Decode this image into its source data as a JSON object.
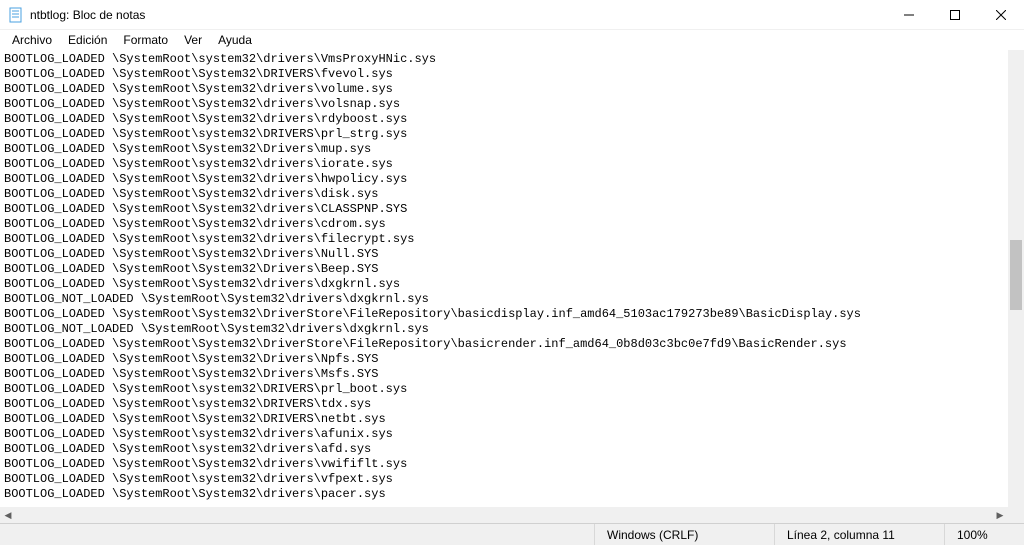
{
  "titlebar": {
    "title": "ntbtlog: Bloc de notas"
  },
  "menu": {
    "file": "Archivo",
    "edit": "Edición",
    "format": "Formato",
    "view": "Ver",
    "help": "Ayuda"
  },
  "lines": [
    "BOOTLOG_LOADED \\SystemRoot\\system32\\drivers\\VmsProxyHNic.sys",
    "BOOTLOG_LOADED \\SystemRoot\\System32\\DRIVERS\\fvevol.sys",
    "BOOTLOG_LOADED \\SystemRoot\\System32\\drivers\\volume.sys",
    "BOOTLOG_LOADED \\SystemRoot\\System32\\drivers\\volsnap.sys",
    "BOOTLOG_LOADED \\SystemRoot\\System32\\drivers\\rdyboost.sys",
    "BOOTLOG_LOADED \\SystemRoot\\system32\\DRIVERS\\prl_strg.sys",
    "BOOTLOG_LOADED \\SystemRoot\\System32\\Drivers\\mup.sys",
    "BOOTLOG_LOADED \\SystemRoot\\system32\\drivers\\iorate.sys",
    "BOOTLOG_LOADED \\SystemRoot\\System32\\drivers\\hwpolicy.sys",
    "BOOTLOG_LOADED \\SystemRoot\\System32\\drivers\\disk.sys",
    "BOOTLOG_LOADED \\SystemRoot\\System32\\drivers\\CLASSPNP.SYS",
    "BOOTLOG_LOADED \\SystemRoot\\System32\\drivers\\cdrom.sys",
    "BOOTLOG_LOADED \\SystemRoot\\system32\\drivers\\filecrypt.sys",
    "BOOTLOG_LOADED \\SystemRoot\\System32\\Drivers\\Null.SYS",
    "BOOTLOG_LOADED \\SystemRoot\\System32\\Drivers\\Beep.SYS",
    "BOOTLOG_LOADED \\SystemRoot\\System32\\drivers\\dxgkrnl.sys",
    "BOOTLOG_NOT_LOADED \\SystemRoot\\System32\\drivers\\dxgkrnl.sys",
    "BOOTLOG_LOADED \\SystemRoot\\System32\\DriverStore\\FileRepository\\basicdisplay.inf_amd64_5103ac179273be89\\BasicDisplay.sys",
    "BOOTLOG_NOT_LOADED \\SystemRoot\\System32\\drivers\\dxgkrnl.sys",
    "BOOTLOG_LOADED \\SystemRoot\\System32\\DriverStore\\FileRepository\\basicrender.inf_amd64_0b8d03c3bc0e7fd9\\BasicRender.sys",
    "BOOTLOG_LOADED \\SystemRoot\\System32\\Drivers\\Npfs.SYS",
    "BOOTLOG_LOADED \\SystemRoot\\System32\\Drivers\\Msfs.SYS",
    "BOOTLOG_LOADED \\SystemRoot\\system32\\DRIVERS\\prl_boot.sys",
    "BOOTLOG_LOADED \\SystemRoot\\system32\\DRIVERS\\tdx.sys",
    "BOOTLOG_LOADED \\SystemRoot\\System32\\DRIVERS\\netbt.sys",
    "BOOTLOG_LOADED \\SystemRoot\\system32\\drivers\\afunix.sys",
    "BOOTLOG_LOADED \\SystemRoot\\system32\\drivers\\afd.sys",
    "BOOTLOG_LOADED \\SystemRoot\\System32\\drivers\\vwififlt.sys",
    "BOOTLOG_LOADED \\SystemRoot\\system32\\drivers\\vfpext.sys",
    "BOOTLOG_LOADED \\SystemRoot\\System32\\drivers\\pacer.sys"
  ],
  "statusbar": {
    "encoding_mode": "Windows (CRLF)",
    "position": "Línea 2, columna 11",
    "zoom": "100%"
  }
}
